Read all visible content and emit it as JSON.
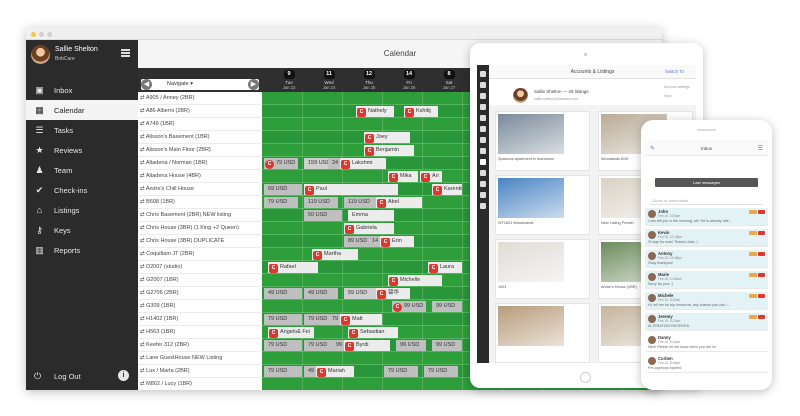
{
  "desktop": {
    "user_name": "Sallie Shelton",
    "company": "BnbCare",
    "nav": [
      {
        "icon": "inbox-icon",
        "glyph": "▣",
        "label": "Inbox"
      },
      {
        "icon": "calendar-icon",
        "glyph": "▦",
        "label": "Calendar",
        "active": true
      },
      {
        "icon": "tasks-icon",
        "glyph": "☰",
        "label": "Tasks"
      },
      {
        "icon": "reviews-icon",
        "glyph": "★",
        "label": "Reviews"
      },
      {
        "icon": "team-icon",
        "glyph": "♟",
        "label": "Team"
      },
      {
        "icon": "check-ins-icon",
        "glyph": "✔",
        "label": "Check-ins"
      },
      {
        "icon": "listings-icon",
        "glyph": "⌂",
        "label": "Listings"
      },
      {
        "icon": "keys-icon",
        "glyph": "⚷",
        "label": "Keys"
      },
      {
        "icon": "reports-icon",
        "glyph": "▥",
        "label": "Reports"
      }
    ],
    "logout_label": "Log Out",
    "calendar": {
      "title": "Calendar",
      "navigate_label": "Navigate",
      "days": [
        {
          "num": "9",
          "name": "Tue",
          "date": "Jan 23"
        },
        {
          "num": "11",
          "name": "Wed",
          "date": "Jan 24"
        },
        {
          "num": "12",
          "name": "Thu",
          "date": "Jan 25"
        },
        {
          "num": "14",
          "name": "Fri",
          "date": "Jan 26"
        },
        {
          "num": "8",
          "name": "Sat",
          "date": "Jan 27"
        }
      ],
      "rows": [
        {
          "label": "A905 / Anney (2BR)",
          "items": []
        },
        {
          "label": "A86 Alberni (2BR)",
          "items": [
            {
              "t": "b",
              "d": 2.3,
              "w": 1.0,
              "text": "Nathely"
            },
            {
              "t": "b",
              "d": 3.5,
              "w": 0.9,
              "text": "Kshitij"
            }
          ]
        },
        {
          "label": "A746 (1BR)",
          "items": []
        },
        {
          "label": "Alisson's Basement (1BR)",
          "items": [
            {
              "t": "b",
              "d": 2.5,
              "w": 1.2,
              "text": "Joey"
            }
          ]
        },
        {
          "label": "Alisson's Main Floor (2BR)",
          "items": [
            {
              "t": "b",
              "d": 2.5,
              "w": 1.3,
              "text": "Benjamin"
            }
          ]
        },
        {
          "label": "Altadena / Norman (1BR)",
          "items": [
            {
              "t": "p",
              "d": 0,
              "w": 0.9,
              "text": "79 USD",
              "badge": true
            },
            {
              "t": "p",
              "d": 1.0,
              "w": 0.9,
              "text": "159 USD",
              "light": true
            },
            {
              "t": "b",
              "d": 1.9,
              "w": 1.2,
              "text": "Lakshmi",
              "pre": "24"
            }
          ]
        },
        {
          "label": "Altadena House (4BR)",
          "items": [
            {
              "t": "b",
              "d": 3.1,
              "w": 0.8,
              "text": "Mika"
            },
            {
              "t": "b",
              "d": 3.9,
              "w": 0.6,
              "text": "Ari"
            }
          ]
        },
        {
          "label": "Andre's Chill House",
          "items": [
            {
              "t": "p",
              "d": 0,
              "w": 1.0,
              "text": "69 USD"
            },
            {
              "t": "b",
              "d": 1.0,
              "w": 2.4,
              "text": "Paul"
            },
            {
              "t": "b",
              "d": 4.2,
              "w": 0.8,
              "text": "Karentina"
            }
          ]
        },
        {
          "label": "B608 (1BR)",
          "items": [
            {
              "t": "p",
              "d": 0,
              "w": 0.9,
              "text": "79 USD"
            },
            {
              "t": "p",
              "d": 1.0,
              "w": 0.9,
              "text": "119 USD"
            },
            {
              "t": "p",
              "d": 2.0,
              "w": 0.9,
              "text": "119 USD"
            },
            {
              "t": "b",
              "d": 2.8,
              "w": 1.2,
              "text": "Abel"
            }
          ]
        },
        {
          "label": "Chris Basement (2BR) NEW listing",
          "items": [
            {
              "t": "p",
              "d": 1.0,
              "w": 1.0,
              "text": "50 USD"
            },
            {
              "t": "b",
              "d": 2.1,
              "w": 1.2,
              "text": "Emma",
              "plain": true
            }
          ]
        },
        {
          "label": "Chris House (3BR) (1 King +2 Queen)",
          "items": [
            {
              "t": "b",
              "d": 2.0,
              "w": 1.3,
              "text": "Gabriela"
            }
          ]
        },
        {
          "label": "Chris House (3BR) DUPLICATE",
          "items": [
            {
              "t": "p",
              "d": 2.0,
              "w": 0.9,
              "text": "89 USD"
            },
            {
              "t": "b",
              "d": 2.9,
              "w": 0.9,
              "text": "Erin",
              "pre": "14"
            }
          ]
        },
        {
          "label": "Coquitlam JT (2BR)",
          "items": [
            {
              "t": "b",
              "d": 1.2,
              "w": 1.2,
              "text": "Martha"
            }
          ]
        },
        {
          "label": "D2007 (studio)",
          "items": [
            {
              "t": "b",
              "d": 0.1,
              "w": 1.3,
              "text": "Rafael"
            },
            {
              "t": "b",
              "d": 4.1,
              "w": 0.9,
              "text": "Laura"
            }
          ]
        },
        {
          "label": "G2007 (1BR)",
          "items": [
            {
              "t": "b",
              "d": 3.1,
              "w": 1.4,
              "text": "Michelle"
            }
          ]
        },
        {
          "label": "G2706 (2BR)",
          "items": [
            {
              "t": "p",
              "d": 0,
              "w": 1.0,
              "text": "49 USD"
            },
            {
              "t": "p",
              "d": 1.0,
              "w": 0.9,
              "text": "49 USD"
            },
            {
              "t": "p",
              "d": 2.0,
              "w": 0.9,
              "text": "59 USD",
              "light": true
            },
            {
              "t": "b",
              "d": 2.8,
              "w": 0.9,
              "text": "锦华"
            }
          ]
        },
        {
          "label": "G309 (1BR)",
          "items": [
            {
              "t": "p",
              "d": 3.2,
              "w": 0.9,
              "text": "99 USD",
              "badge": true
            },
            {
              "t": "p",
              "d": 4.2,
              "w": 0.8,
              "text": "99 USD"
            }
          ]
        },
        {
          "label": "H1402 (1BR)",
          "items": [
            {
              "t": "p",
              "d": 0,
              "w": 1.0,
              "text": "79 USD"
            },
            {
              "t": "p",
              "d": 1.0,
              "w": 0.9,
              "text": "79 USD"
            },
            {
              "t": "b",
              "d": 1.9,
              "w": 1.1,
              "text": "Matt",
              "pre": "79"
            }
          ]
        },
        {
          "label": "H563 (1BR)",
          "items": [
            {
              "t": "b",
              "d": 0.1,
              "w": 1.2,
              "text": "Angelo& Fei"
            },
            {
              "t": "b",
              "d": 2.1,
              "w": 1.3,
              "text": "Sebastian"
            }
          ]
        },
        {
          "label": "Keefer 312 (2BR)",
          "items": [
            {
              "t": "p",
              "d": 0,
              "w": 1.0,
              "text": "79 USD"
            },
            {
              "t": "p",
              "d": 1.0,
              "w": 0.9,
              "text": "79 USD"
            },
            {
              "t": "b",
              "d": 2.0,
              "w": 1.2,
              "text": "Byrdi",
              "pre": "99"
            },
            {
              "t": "p",
              "d": 3.3,
              "w": 0.8,
              "text": "99 USD"
            },
            {
              "t": "p",
              "d": 4.2,
              "w": 0.8,
              "text": "99 USD"
            }
          ]
        },
        {
          "label": "Lane GuestHouse NEW Listing",
          "items": []
        },
        {
          "label": "Lux / Marta (2BR)",
          "items": [
            {
              "t": "p",
              "d": 0,
              "w": 1.0,
              "text": "79 USD"
            },
            {
              "t": "b",
              "d": 1.3,
              "w": 1.0,
              "text": "Mariah",
              "pre": "49"
            },
            {
              "t": "p",
              "d": 3.0,
              "w": 0.9,
              "text": "79 USD"
            },
            {
              "t": "p",
              "d": 4.0,
              "w": 0.9,
              "text": "79 USD"
            }
          ]
        },
        {
          "label": "M802 / Lucy (1BR)",
          "items": []
        }
      ]
    }
  },
  "tablet": {
    "title": "Accounts & Listings",
    "switch_label": "Switch To",
    "profile_name": "Sallie Shelton — 28 listings",
    "profile_email": "sallie.shelton@bnbcare.com",
    "account_label": "Account settings",
    "sync_label": "Sync",
    "listings": [
      {
        "caption": "Spacious apartment in downtown",
        "color": "#7a8a9a"
      },
      {
        "caption": "Woodlands 8/49",
        "color": "#b9ab96"
      },
      {
        "caption": "WT1601 Woodwards",
        "color": "#4a84c4"
      },
      {
        "caption": "New Listing Pender",
        "color": "#d9d2c4"
      },
      {
        "caption": "J403",
        "color": "#e0dcd6"
      },
      {
        "caption": "Andre's House (2BR)",
        "color": "#6c8c5c"
      },
      {
        "caption": "",
        "color": "#b79c7a"
      },
      {
        "caption": "",
        "color": "#c4b49c"
      }
    ]
  },
  "phone": {
    "title": "Inbox",
    "last_messages_label": "Last messages",
    "search_placeholder": "Guest or reservation",
    "messages": [
      {
        "name": "John",
        "date": "Feb 15, 3:29pm",
        "text": "I can tell you in the morning, ok? He is already ride...",
        "hl": true
      },
      {
        "name": "Kevin",
        "date": "Feb 15, 12:15pm",
        "text": "I'll stay for sure! Thanks John :)",
        "hl": true
      },
      {
        "name": "Antony",
        "date": "Feb 15, 12:48pm",
        "text": "Okay thankyou!",
        "hl": true
      },
      {
        "name": "Marie",
        "date": "Feb 15, 11:55am",
        "text": "Sorry No pics :)",
        "hl": true
      },
      {
        "name": "Michele",
        "date": "Feb 15, 8:42am",
        "text": "Hi, tell me for trip tomorrow, any chance you can l...",
        "hl": true
      },
      {
        "name": "Jeremy",
        "date": "Feb 15, 5:13am",
        "text": "ALTERATION RECEIVED",
        "hl": true
      },
      {
        "name": "Danny",
        "date": "Feb 14, 9:42pm",
        "text": "Nice! Please let me know when you are in!",
        "hl": false
      },
      {
        "name": "Corben",
        "date": "Feb 14, 8:18pm",
        "text": "Pre-approval expired",
        "hl": false
      }
    ]
  }
}
